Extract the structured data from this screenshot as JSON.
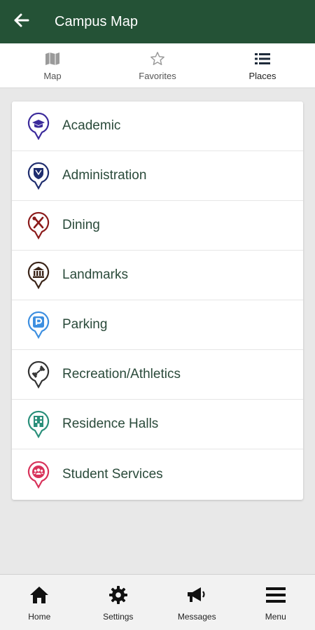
{
  "header": {
    "title": "Campus Map"
  },
  "tabs": [
    {
      "label": "Map",
      "icon": "map-icon",
      "active": false
    },
    {
      "label": "Favorites",
      "icon": "star-outline-icon",
      "active": false
    },
    {
      "label": "Places",
      "icon": "list-icon",
      "active": true
    }
  ],
  "places": [
    {
      "label": "Academic",
      "icon": "graduation-cap-icon",
      "color": "#3b2a9b"
    },
    {
      "label": "Administration",
      "icon": "shield-icon",
      "color": "#1f2d6e"
    },
    {
      "label": "Dining",
      "icon": "utensils-icon",
      "color": "#8b1a1a"
    },
    {
      "label": "Landmarks",
      "icon": "landmark-icon",
      "color": "#3a2418"
    },
    {
      "label": "Parking",
      "icon": "parking-icon",
      "color": "#3d8fe0"
    },
    {
      "label": "Recreation/Athletics",
      "icon": "dumbbell-icon",
      "color": "#333333"
    },
    {
      "label": "Residence Halls",
      "icon": "building-icon",
      "color": "#2a8f7a"
    },
    {
      "label": "Student Services",
      "icon": "users-icon",
      "color": "#d8325a"
    }
  ],
  "bottom_nav": [
    {
      "label": "Home",
      "icon": "home-icon"
    },
    {
      "label": "Settings",
      "icon": "gear-icon"
    },
    {
      "label": "Messages",
      "icon": "megaphone-icon"
    },
    {
      "label": "Menu",
      "icon": "hamburger-menu-icon"
    }
  ],
  "colors": {
    "header_bg": "#245236"
  }
}
